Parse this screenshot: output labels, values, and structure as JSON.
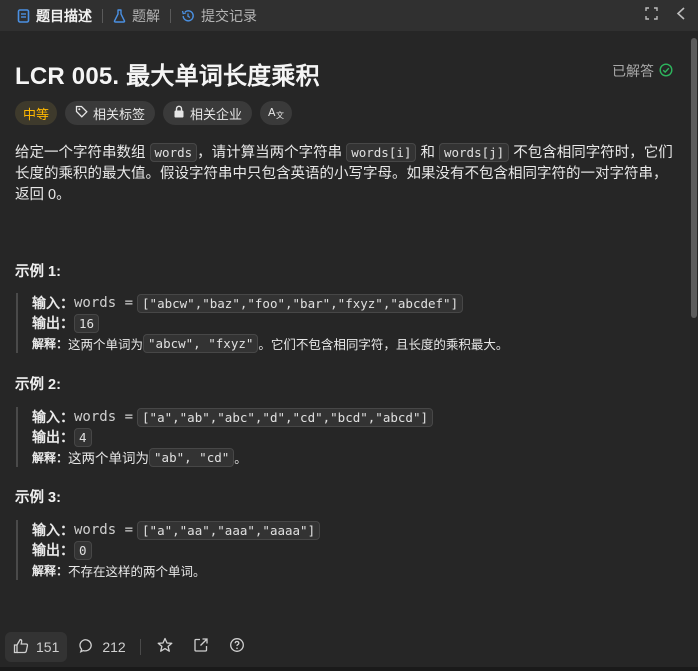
{
  "tabs": [
    {
      "label": "题目描述",
      "icon": "description-icon",
      "active": true
    },
    {
      "label": "题解",
      "icon": "flask-icon",
      "active": false
    },
    {
      "label": "提交记录",
      "icon": "history-icon",
      "active": false
    }
  ],
  "problem": {
    "title": "LCR 005. 最大单词长度乘积",
    "status": "已解答",
    "status_color": "#2db55d"
  },
  "tags": {
    "difficulty": "中等",
    "difficulty_color": "#ffb800",
    "related_tags": "相关标签",
    "related_companies": "相关企业",
    "translate_icon": "translate-icon"
  },
  "description": {
    "p1": "给定一个字符串数组 ",
    "code1": "words",
    "p2": "，请计算当两个字符串 ",
    "code2": "words[i]",
    "p3": " 和 ",
    "code3": "words[j]",
    "p4": " 不包含相同字符时，它们长度的乘积的最大值。假设字符串中只包含英语的小写字母。如果没有不包含相同字符的一对字符串，返回 0。"
  },
  "examples": [
    {
      "title": "示例 1:",
      "input_label": "输入：",
      "input_var": "words =",
      "input_value": "[\"abcw\",\"baz\",\"foo\",\"bar\",\"fxyz\",\"abcdef\"]",
      "output_label": "输出：",
      "output_value": "16",
      "explain_label": "解释：",
      "explain_pre": "这两个单词为 ",
      "explain_code": "\"abcw\", \"fxyz\"",
      "explain_post": "。它们不包含相同字符，且长度的乘积最大。"
    },
    {
      "title": "示例 2:",
      "input_label": "输入：",
      "input_var": "words =",
      "input_value": "[\"a\",\"ab\",\"abc\",\"d\",\"cd\",\"bcd\",\"abcd\"]",
      "output_label": "输出：",
      "output_value": "4",
      "explain_label": "解释：",
      "explain_pre": "这两个单词为 ",
      "explain_code": "\"ab\", \"cd\"",
      "explain_post": "。"
    },
    {
      "title": "示例 3:",
      "input_label": "输入：",
      "input_var": "words =",
      "input_value": "[\"a\",\"aa\",\"aaa\",\"aaaa\"]",
      "output_label": "输出：",
      "output_value": "0",
      "explain_label": "解释：",
      "explain_pre": "不存在这样的两个单词。",
      "explain_code": "",
      "explain_post": ""
    }
  ],
  "bottom": {
    "likes": "151",
    "comments": "212"
  }
}
